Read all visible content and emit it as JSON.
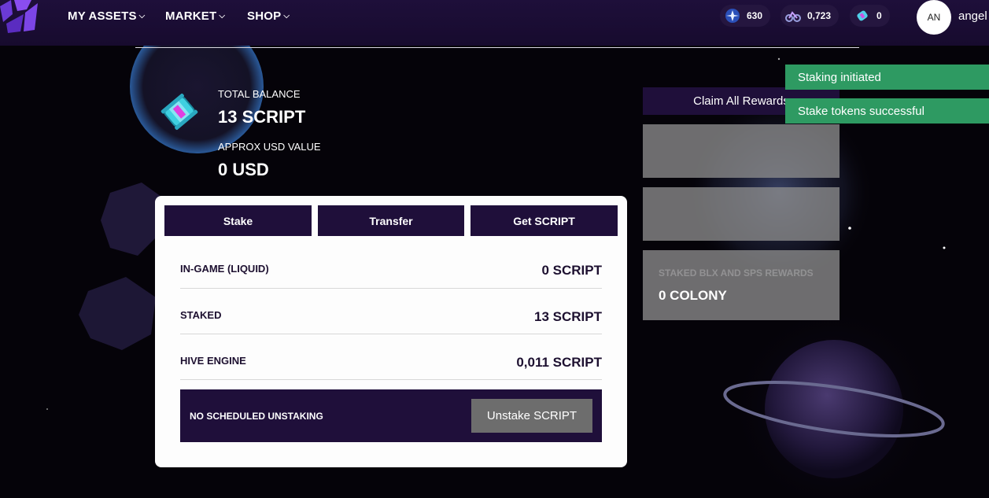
{
  "colors": {
    "header_bg": "#1e0f3a",
    "accent_dark": "#1f0f3a",
    "toast_green": "#2e9a62",
    "button_gray": "#6d6d6d"
  },
  "nav": {
    "items": [
      {
        "label": "MY ASSETS",
        "icon": "chevron-down-icon"
      },
      {
        "label": "MARKET",
        "icon": "chevron-down-icon"
      },
      {
        "label": "SHOP",
        "icon": "chevron-down-icon"
      }
    ]
  },
  "currencies": [
    {
      "icon": "star-coin-icon",
      "value": "630"
    },
    {
      "icon": "bike-icon",
      "value": "0,723"
    },
    {
      "icon": "script-capsule-icon",
      "value": "0"
    }
  ],
  "user": {
    "initials": "AN",
    "name": "angel"
  },
  "balance": {
    "total_label": "TOTAL BALANCE",
    "total_value": "13 SCRIPT",
    "usd_label": "APPROX USD VALUE",
    "usd_value": "0 USD"
  },
  "card": {
    "tabs": [
      "Stake",
      "Transfer",
      "Get SCRIPT"
    ],
    "rows": [
      {
        "label": "IN-GAME (LIQUID)",
        "value": "0 SCRIPT"
      },
      {
        "label": "STAKED",
        "value": "13 SCRIPT"
      },
      {
        "label": "HIVE ENGINE",
        "value": "0,011 SCRIPT"
      }
    ],
    "unstake_label": "NO SCHEDULED UNSTAKING",
    "unstake_button": "Unstake SCRIPT"
  },
  "rewards": {
    "claim_button": "Claim All Rewards",
    "card3_faint": "STAKED BLX AND SPS REWARDS",
    "card3_value": "0 COLONY"
  },
  "toasts": [
    "Staking initiated",
    "Stake tokens successful"
  ]
}
